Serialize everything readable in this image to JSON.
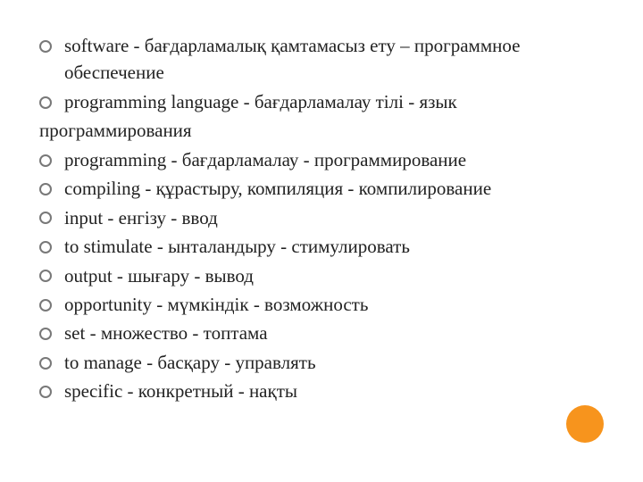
{
  "accent_color": "#f7941d",
  "items": [
    {
      "text": "software - бағдарламалық қамтамасыз ету – программное обеспечение",
      "wrap_outside_bullet": false
    },
    {
      "text": "programming language - бағдарламалау тілі - язык",
      "wrap_outside_bullet": true,
      "continuation": "программирования"
    },
    {
      "text": "programming - бағдарламалау - программирование",
      "wrap_outside_bullet": false
    },
    {
      "text": "compiling - құрастыру, компиляция - компилирование",
      "wrap_outside_bullet": false
    },
    {
      "text": "input - енгізу - ввод",
      "wrap_outside_bullet": false
    },
    {
      "text": "to stimulate - ынталандыру - стимулировать",
      "wrap_outside_bullet": false
    },
    {
      "text": "output - шығару - вывод",
      "wrap_outside_bullet": false
    },
    {
      "text": "opportunity - мүмкіндік - возможность",
      "wrap_outside_bullet": false
    },
    {
      "text": "set - множество - топтама",
      "wrap_outside_bullet": false
    },
    {
      "text": "to manage - басқару - управлять",
      "wrap_outside_bullet": false
    },
    {
      "text": "specific - конкретный - нақты",
      "wrap_outside_bullet": false
    }
  ]
}
